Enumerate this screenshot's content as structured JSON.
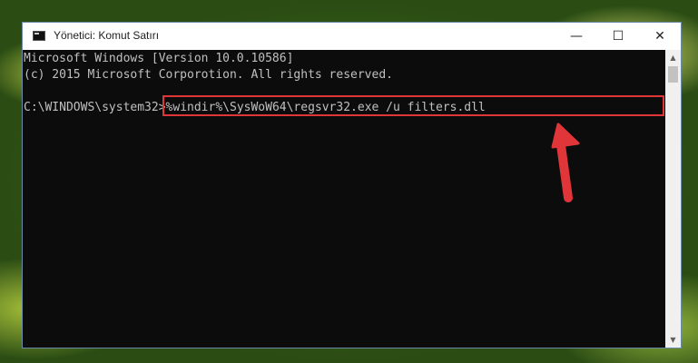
{
  "window": {
    "title": "Yönetici: Komut Satırı",
    "controls": {
      "minimize": "—",
      "maximize": "☐",
      "close": "✕"
    }
  },
  "console": {
    "line1": "Microsoft Windows [Version 10.0.10586]",
    "line2": "(c) 2015 Microsoft Corporotion. All rights reserved.",
    "prompt": "C:\\WINDOWS\\system32>",
    "command": "%windir%\\SysWoW64\\regsvr32.exe /u filters.dll"
  },
  "scrollbar": {
    "up": "▲",
    "down": "▼"
  },
  "colors": {
    "highlight": "#e0363a",
    "console_bg": "#0c0c0c",
    "console_text": "#c0c0c0"
  }
}
